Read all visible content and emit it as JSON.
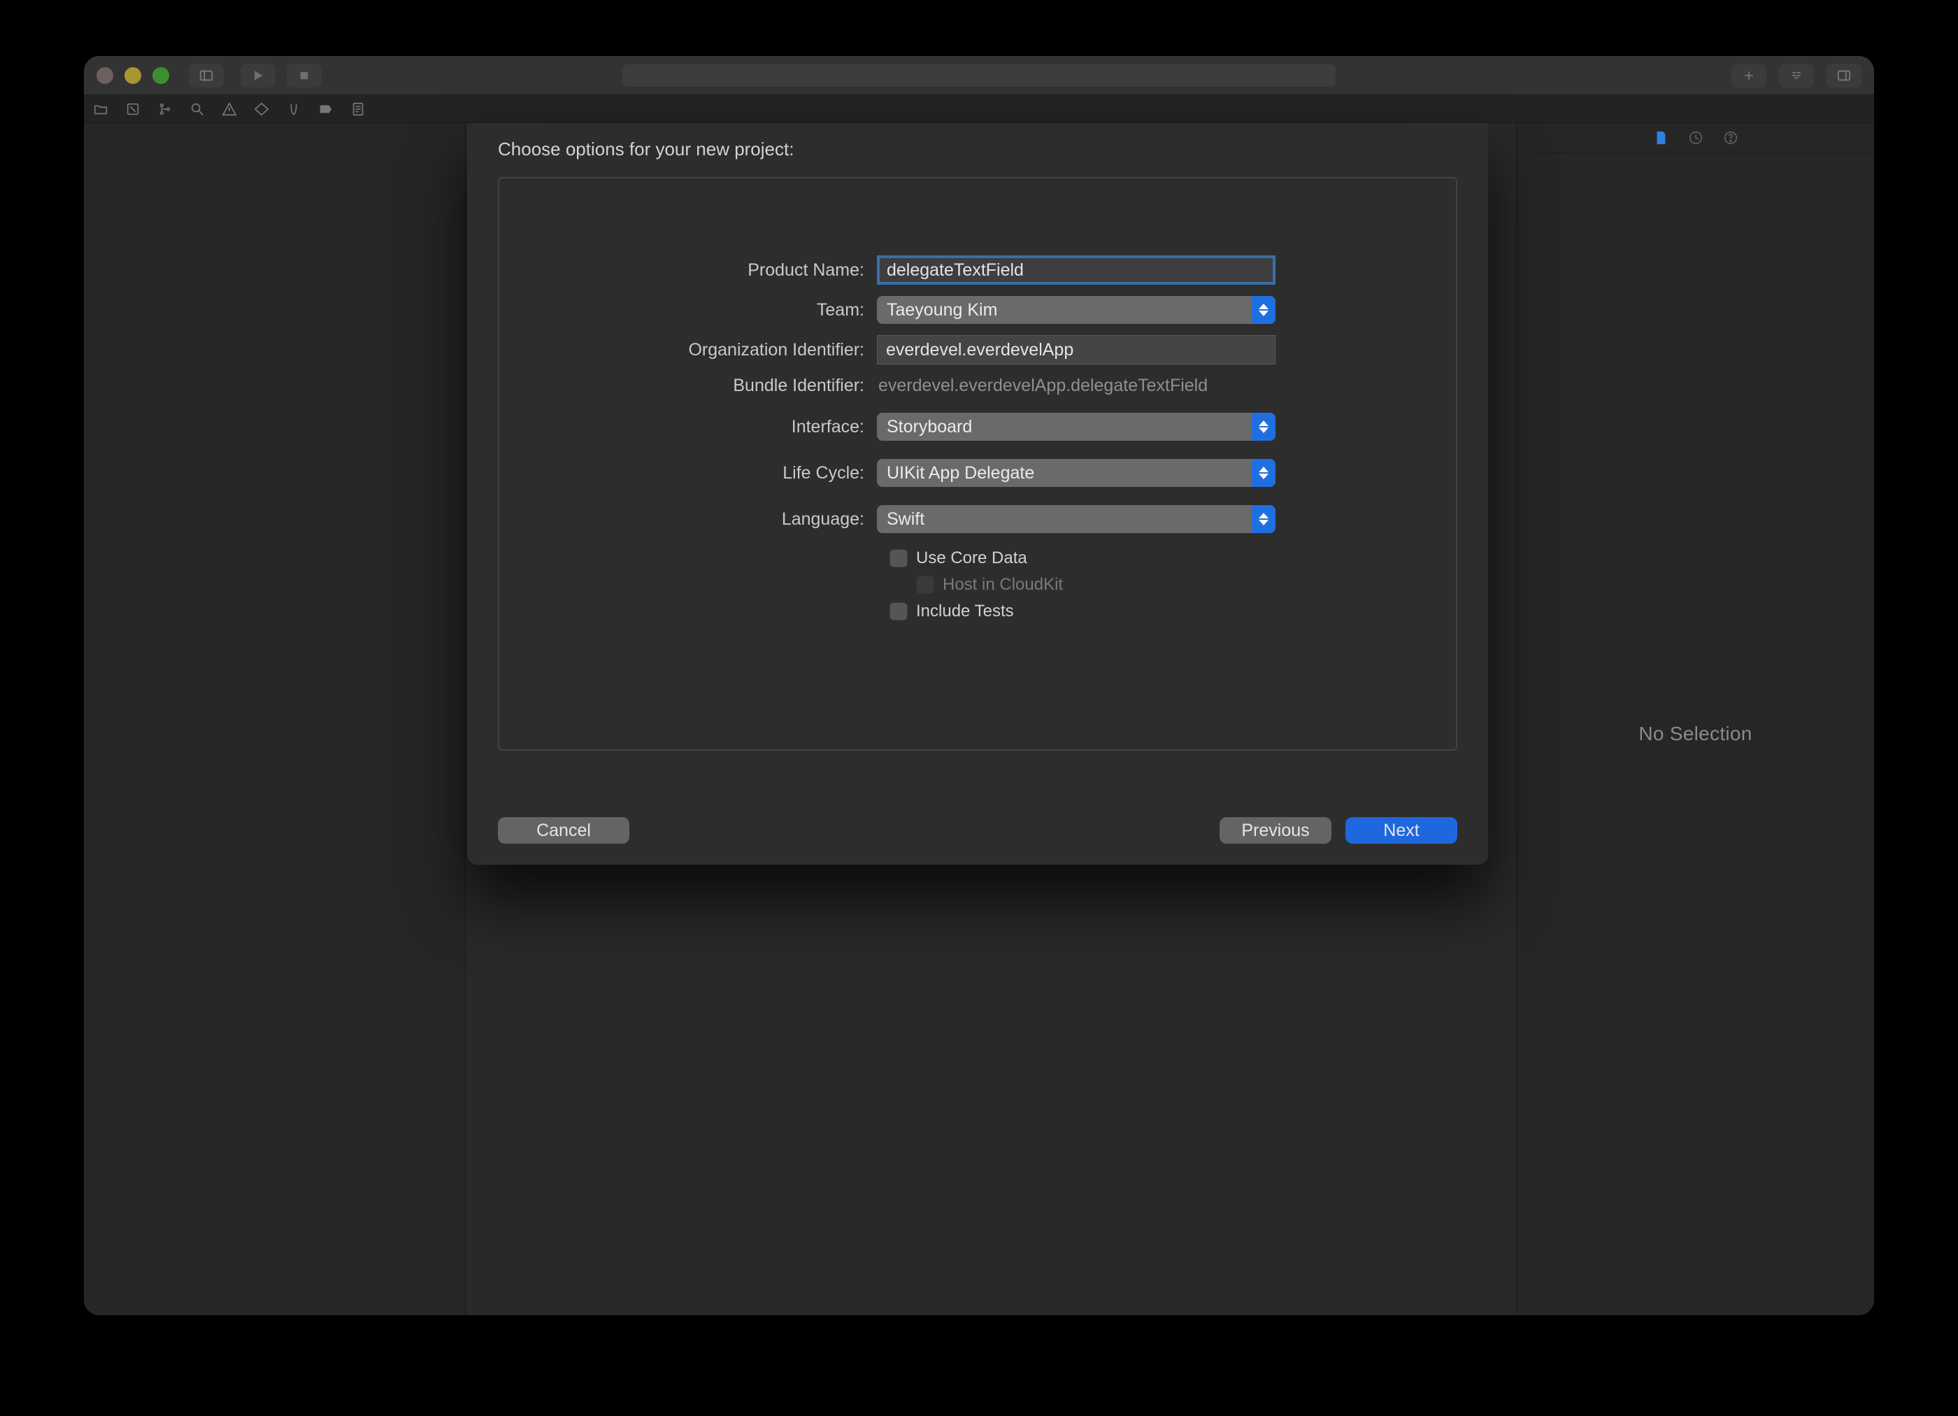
{
  "window": {
    "titlebar": {
      "center_placeholder": ""
    }
  },
  "right_panel": {
    "empty_text": "No Selection"
  },
  "sheet": {
    "title": "Choose options for your new project:",
    "labels": {
      "product_name": "Product Name:",
      "team": "Team:",
      "org_id": "Organization Identifier:",
      "bundle_id": "Bundle Identifier:",
      "interface": "Interface:",
      "life_cycle": "Life Cycle:",
      "language": "Language:"
    },
    "values": {
      "product_name": "delegateTextField",
      "team": "Taeyoung Kim",
      "org_id": "everdevel.everdevelApp",
      "bundle_id": "everdevel.everdevelApp.delegateTextField",
      "interface": "Storyboard",
      "life_cycle": "UIKit App Delegate",
      "language": "Swift"
    },
    "checkboxes": {
      "use_core_data": "Use Core Data",
      "host_cloudkit": "Host in CloudKit",
      "include_tests": "Include Tests"
    },
    "buttons": {
      "cancel": "Cancel",
      "previous": "Previous",
      "next": "Next"
    }
  }
}
